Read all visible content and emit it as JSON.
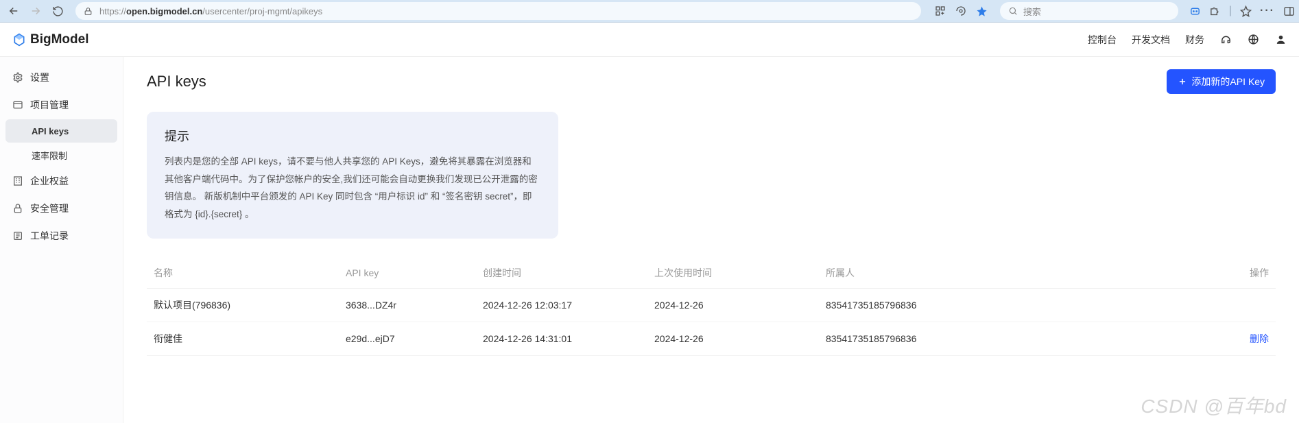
{
  "browser": {
    "url_prefix": "https://",
    "url_host": "open.bigmodel.cn",
    "url_path": "/usercenter/proj-mgmt/apikeys",
    "search_placeholder": "搜索"
  },
  "header": {
    "brand": "BigModel",
    "links": {
      "console": "控制台",
      "docs": "开发文档",
      "billing": "财务"
    }
  },
  "sidebar": {
    "settings": "设置",
    "project": "项目管理",
    "apikeys": "API keys",
    "ratelimit": "速率限制",
    "enterprise": "企业权益",
    "security": "安全管理",
    "ticket": "工单记录"
  },
  "page": {
    "title": "API keys",
    "add_button": "添加新的API Key",
    "tip_title": "提示",
    "tip_body": "列表内是您的全部 API keys，请不要与他人共享您的 API Keys，避免将其暴露在浏览器和其他客户端代码中。为了保护您帐户的安全,我们还可能会自动更换我们发现已公开泄露的密钥信息。 新版机制中平台颁发的 API Key 同时包含 “用户标识 id” 和 “签名密钥 secret”，即格式为 {id}.{secret} 。"
  },
  "table": {
    "columns": {
      "name": "名称",
      "key": "API key",
      "created": "创建时间",
      "last_used": "上次使用时间",
      "owner": "所属人",
      "action": "操作"
    },
    "rows": [
      {
        "name": "默认项目(796836)",
        "key": "3638...DZ4r",
        "created": "2024-12-26 12:03:17",
        "last_used": "2024-12-26",
        "owner": "83541735185796836",
        "action": ""
      },
      {
        "name": "衔健佳",
        "key": "e29d...ejD7",
        "created": "2024-12-26 14:31:01",
        "last_used": "2024-12-26",
        "owner": "83541735185796836",
        "action": "删除"
      }
    ]
  },
  "watermark": "CSDN @百年bd"
}
